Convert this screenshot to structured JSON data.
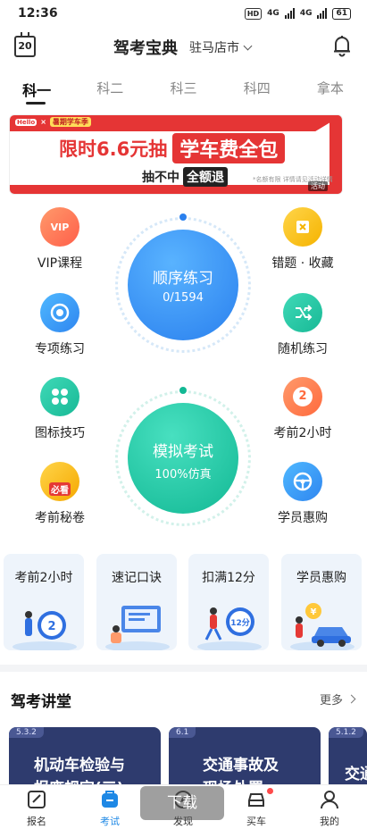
{
  "status_bar": {
    "time": "12:36",
    "hd": "HD",
    "network1": "4G",
    "network2": "4G",
    "battery": "61"
  },
  "header": {
    "calendar_day": "20",
    "title": "驾考宝典",
    "city": "驻马店市"
  },
  "tabs": [
    {
      "label": "科一"
    },
    {
      "label": "科二"
    },
    {
      "label": "科三"
    },
    {
      "label": "科四"
    },
    {
      "label": "拿本"
    }
  ],
  "banner": {
    "logo": "Hello",
    "season": "暑期学车季",
    "lead": "限时6.6元抽",
    "highlight": "学车费全包",
    "sub_lead": "抽不中",
    "sub_box": "全额退",
    "note": "*名额有限 详情请见活动详情",
    "ad_label": "活动"
  },
  "practice": {
    "vip": "VIP课程",
    "vip_badge": "VIP",
    "mistakes": "错题 · 收藏",
    "special": "专项练习",
    "random": "随机练习",
    "sign_tips": "图标技巧",
    "last2h": "考前2小时",
    "last2h_badge": "2",
    "secret": "考前秘卷",
    "secret_badge": "必看",
    "student_deals": "学员惠购",
    "sequential": {
      "title": "顺序练习",
      "progress": "0/1594"
    },
    "mock": {
      "title": "模拟考试",
      "sub": "100%仿真"
    }
  },
  "cards": [
    {
      "title": "考前2小时",
      "badge": "2"
    },
    {
      "title": "速记口诀"
    },
    {
      "title": "扣满12分",
      "badge": "12分"
    },
    {
      "title": "学员惠购",
      "badge": "¥"
    }
  ],
  "lectures": {
    "section_title": "驾考讲堂",
    "more": "更多",
    "items": [
      {
        "code": "5.3.2",
        "line1": "机动车检验与",
        "line2": "报废规定(三)"
      },
      {
        "code": "6.1",
        "line1": "交通事故及",
        "line2": "现场处置"
      },
      {
        "code": "5.1.2",
        "line1": "交通"
      }
    ]
  },
  "download_overlay": "下载",
  "bottom_nav": [
    {
      "label": "报名"
    },
    {
      "label": "考试"
    },
    {
      "label": "发现"
    },
    {
      "label": "买车"
    },
    {
      "label": "我的"
    }
  ],
  "colors": {
    "accent": "#1e88e5",
    "banner_red": "#e53535",
    "seq_blue": "#2f8ff0",
    "mock_green": "#1fc3a3"
  }
}
